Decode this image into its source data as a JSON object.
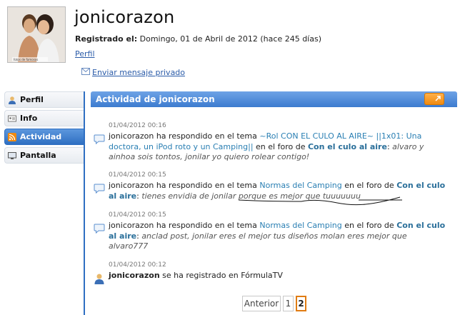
{
  "profile": {
    "username": "jonicorazon",
    "registered_label": "Registrado el:",
    "registered_value": "Domingo, 01 de Abril de 2012 (hace 245 días)",
    "perfil_link": "Perfil",
    "send_message": "Enviar mensaje privado",
    "avatar_caption": "fotos de famosos"
  },
  "sidebar": {
    "items": [
      {
        "label": "Perfil",
        "icon": "user-icon",
        "active": false
      },
      {
        "label": "Info",
        "icon": "id-card-icon",
        "active": false
      },
      {
        "label": "Actividad",
        "icon": "rss-icon",
        "active": true
      },
      {
        "label": "Pantalla",
        "icon": "monitor-icon",
        "active": false
      }
    ]
  },
  "panel": {
    "title": "Actividad de jonicorazon"
  },
  "activity": [
    {
      "time": "01/04/2012 00:16",
      "user": "jonicorazon",
      "action": " ha respondido en el tema ",
      "topic": "~Rol CON EL CULO AL AIRE~ ||1x01: Una doctora, un iPod roto y un Camping||",
      "forum_prefix": " en el foro de ",
      "forum": "Con el culo al aire",
      "colon": ": ",
      "quote": "alvaro y ainhoa sois tontos, jonilar yo quiero rolear contigo!"
    },
    {
      "time": "01/04/2012 00:15",
      "user": "jonicorazon",
      "action": " ha respondido en el tema ",
      "topic": "Normas del Camping",
      "forum_prefix": " en el foro de ",
      "forum": "Con el culo al aire",
      "colon": ": ",
      "quote": "tienes envidia de jonilar porque es mejor que tuuuuuuu"
    },
    {
      "time": "01/04/2012 00:15",
      "user": "jonicorazon",
      "action": " ha respondido en el tema ",
      "topic": "Normas del Camping",
      "forum_prefix": " en el foro de ",
      "forum": "Con el culo al aire",
      "colon": ": ",
      "quote": "anclad post, jonilar eres el mejor tus diseños molan eres mejor que alvaro777"
    }
  ],
  "registration": {
    "time": "01/04/2012 00:12",
    "user": "jonicorazon",
    "text": " se ha registrado en FórmulaTV"
  },
  "pager": {
    "prev": "Anterior",
    "pages": [
      "1",
      "2"
    ],
    "current": "2"
  },
  "colors": {
    "accent": "#2f6fc2",
    "link": "#2a7fb3",
    "orange": "#f08a10"
  }
}
